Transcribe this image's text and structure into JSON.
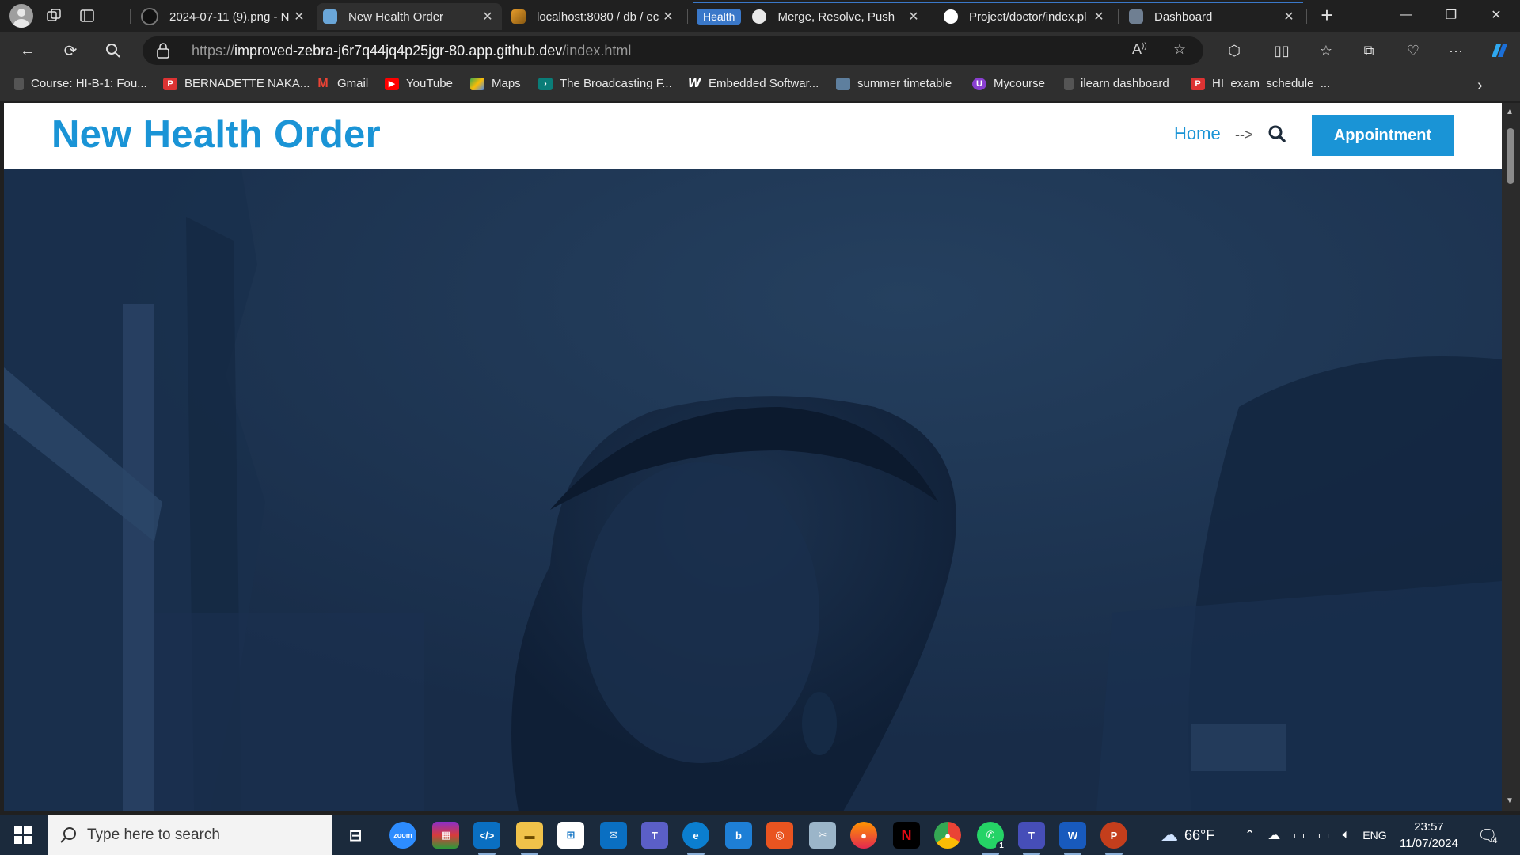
{
  "browser": {
    "tabs": [
      {
        "title": "2024-07-11 (9).png - N",
        "favicon": "github-icon",
        "active": false
      },
      {
        "title": "New Health Order",
        "favicon": "site-icon",
        "active": true
      },
      {
        "title": "localhost:8080 / db / ec",
        "favicon": "phpmyadmin-icon",
        "active": false
      },
      {
        "title": "Merge, Resolve, Push",
        "favicon": "chatgpt-icon",
        "active": false,
        "group": "Health"
      },
      {
        "title": "Project/doctor/index.pl",
        "favicon": "github-icon",
        "active": false,
        "group": "Health"
      },
      {
        "title": "Dashboard",
        "favicon": "site-icon",
        "active": false,
        "group": "Health"
      }
    ],
    "tab_group_label": "Health",
    "address": {
      "scheme": "https://",
      "host": "improved-zebra-j6r7q44jq4p25jgr-80.app.github.dev",
      "path": "/index.html"
    },
    "bookmarks": [
      {
        "label": "Course: HI-B-1: Fou...",
        "icon": "page-icon"
      },
      {
        "label": "BERNADETTE NAKA...",
        "icon": "pdf-icon"
      },
      {
        "label": "Gmail",
        "icon": "gmail-icon"
      },
      {
        "label": "YouTube",
        "icon": "youtube-icon"
      },
      {
        "label": "Maps",
        "icon": "maps-icon"
      },
      {
        "label": "The Broadcasting F...",
        "icon": "arrow-icon"
      },
      {
        "label": "Embedded Softwar...",
        "icon": "w-icon"
      },
      {
        "label": "summer timetable",
        "icon": "image-icon"
      },
      {
        "label": "Mycourse",
        "icon": "mycourse-icon"
      },
      {
        "label": "ilearn dashboard",
        "icon": "page-icon"
      },
      {
        "label": "HI_exam_schedule_...",
        "icon": "pdf-icon"
      }
    ]
  },
  "site": {
    "logo": "New Health Order",
    "nav": {
      "home": "Home",
      "arrow": "-->"
    },
    "cta": "Appointment",
    "colors": {
      "brand": "#1a94d6",
      "hero_overlay": "#1b3150"
    }
  },
  "taskbar": {
    "search_placeholder": "Type here to search",
    "apps": [
      "zoom",
      "winrar",
      "vscode",
      "file-explorer",
      "store",
      "mail",
      "teams",
      "edge",
      "bing",
      "ubuntu",
      "snipping",
      "firefox",
      "netflix",
      "chrome",
      "whatsapp",
      "teams-classic",
      "word",
      "powerpoint"
    ],
    "whatsapp_badge": "1",
    "weather": "66°F",
    "language": "ENG",
    "time": "23:57",
    "date": "11/07/2024",
    "notifications": "4"
  }
}
